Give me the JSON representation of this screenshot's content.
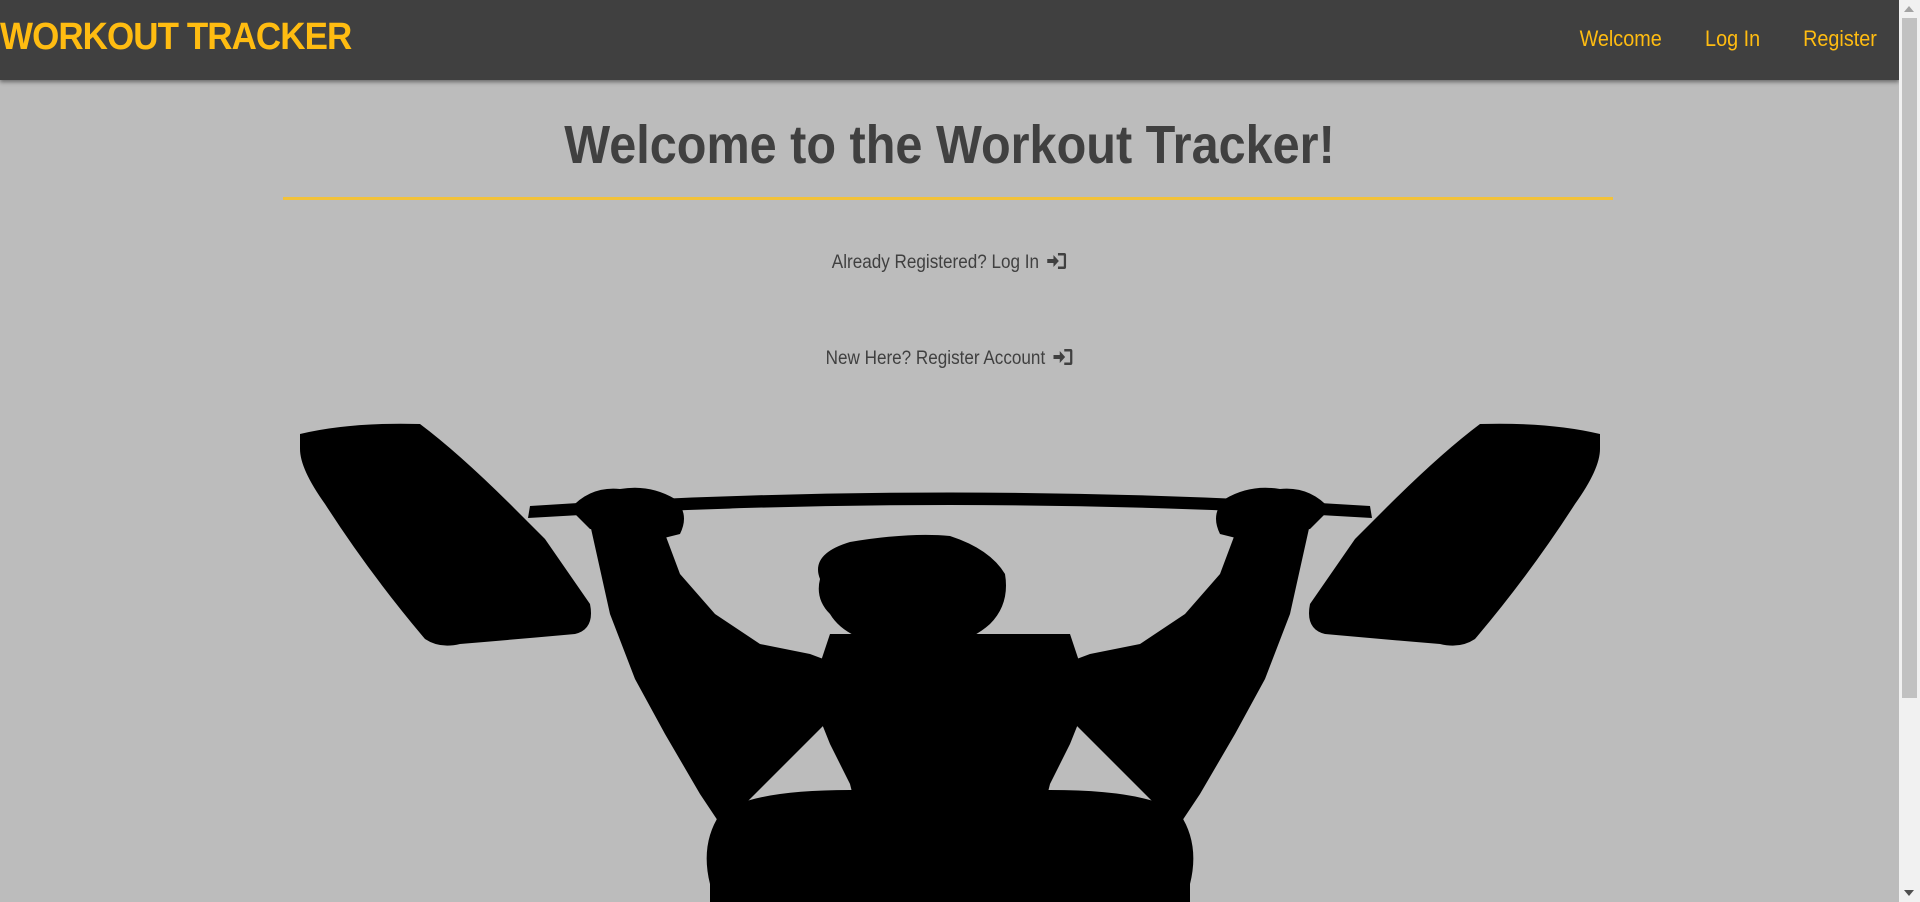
{
  "navbar": {
    "brand": "WORKOUT TRACKER",
    "links": [
      {
        "label": "Welcome"
      },
      {
        "label": "Log In"
      },
      {
        "label": "Register"
      }
    ]
  },
  "main": {
    "title": "Welcome to the Workout Tracker!",
    "login_prompt": "Already Registered? Log In",
    "register_prompt": "New Here? Register Account",
    "image_name": "weightlifter-silhouette"
  },
  "icons": {
    "signin": "sign-in-icon"
  },
  "colors": {
    "accent": "#ffbc11",
    "navbar_bg": "#404040",
    "page_bg": "#bcbcbc",
    "text": "#404040",
    "divider": "#f2c23a"
  }
}
